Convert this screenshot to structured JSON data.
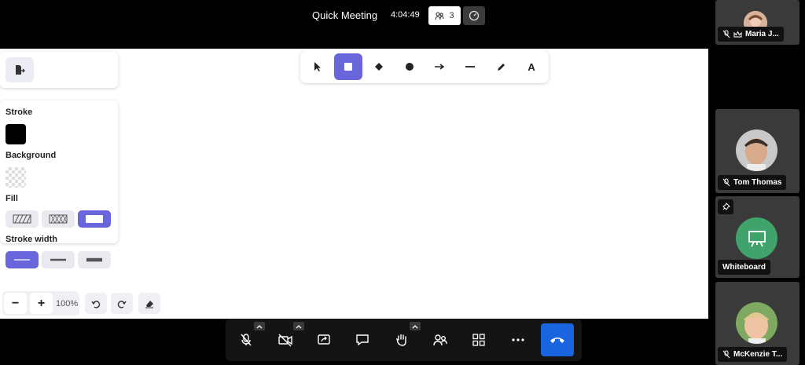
{
  "meeting": {
    "title": "Quick Meeting",
    "timer": "4:04:49",
    "participant_count": "3"
  },
  "whiteboard": {
    "tools": [
      "select",
      "rectangle",
      "diamond",
      "ellipse",
      "arrow",
      "line",
      "draw",
      "text"
    ],
    "active_tool": "rectangle",
    "text_tool_label": "A",
    "properties": {
      "stroke_label": "Stroke",
      "background_label": "Background",
      "fill_label": "Fill",
      "stroke_width_label": "Stroke width",
      "stroke_color": "#000000",
      "background_color": "transparent",
      "fill_options": [
        "hachure",
        "cross-hatch",
        "solid"
      ],
      "fill_selected": "solid",
      "stroke_width_options": [
        "thin",
        "bold",
        "extra-bold"
      ],
      "stroke_width_selected": "thin"
    },
    "zoom": {
      "minus": "−",
      "plus": "+",
      "level": "100%"
    },
    "accent_color": "#6965db"
  },
  "controls": {
    "buttons": [
      "microphone-muted",
      "camera-off",
      "share-screen",
      "chat",
      "raise-hand",
      "participants",
      "tile-view",
      "more",
      "end-call"
    ],
    "end_call_color": "#1965e0"
  },
  "participants": [
    {
      "name": "Maria J...",
      "muted": true,
      "moderator": true
    },
    {
      "name": "Tom Thomas",
      "muted": true
    },
    {
      "name": "Whiteboard",
      "pinned": false
    },
    {
      "name": "McKenzie T...",
      "muted": true
    }
  ]
}
